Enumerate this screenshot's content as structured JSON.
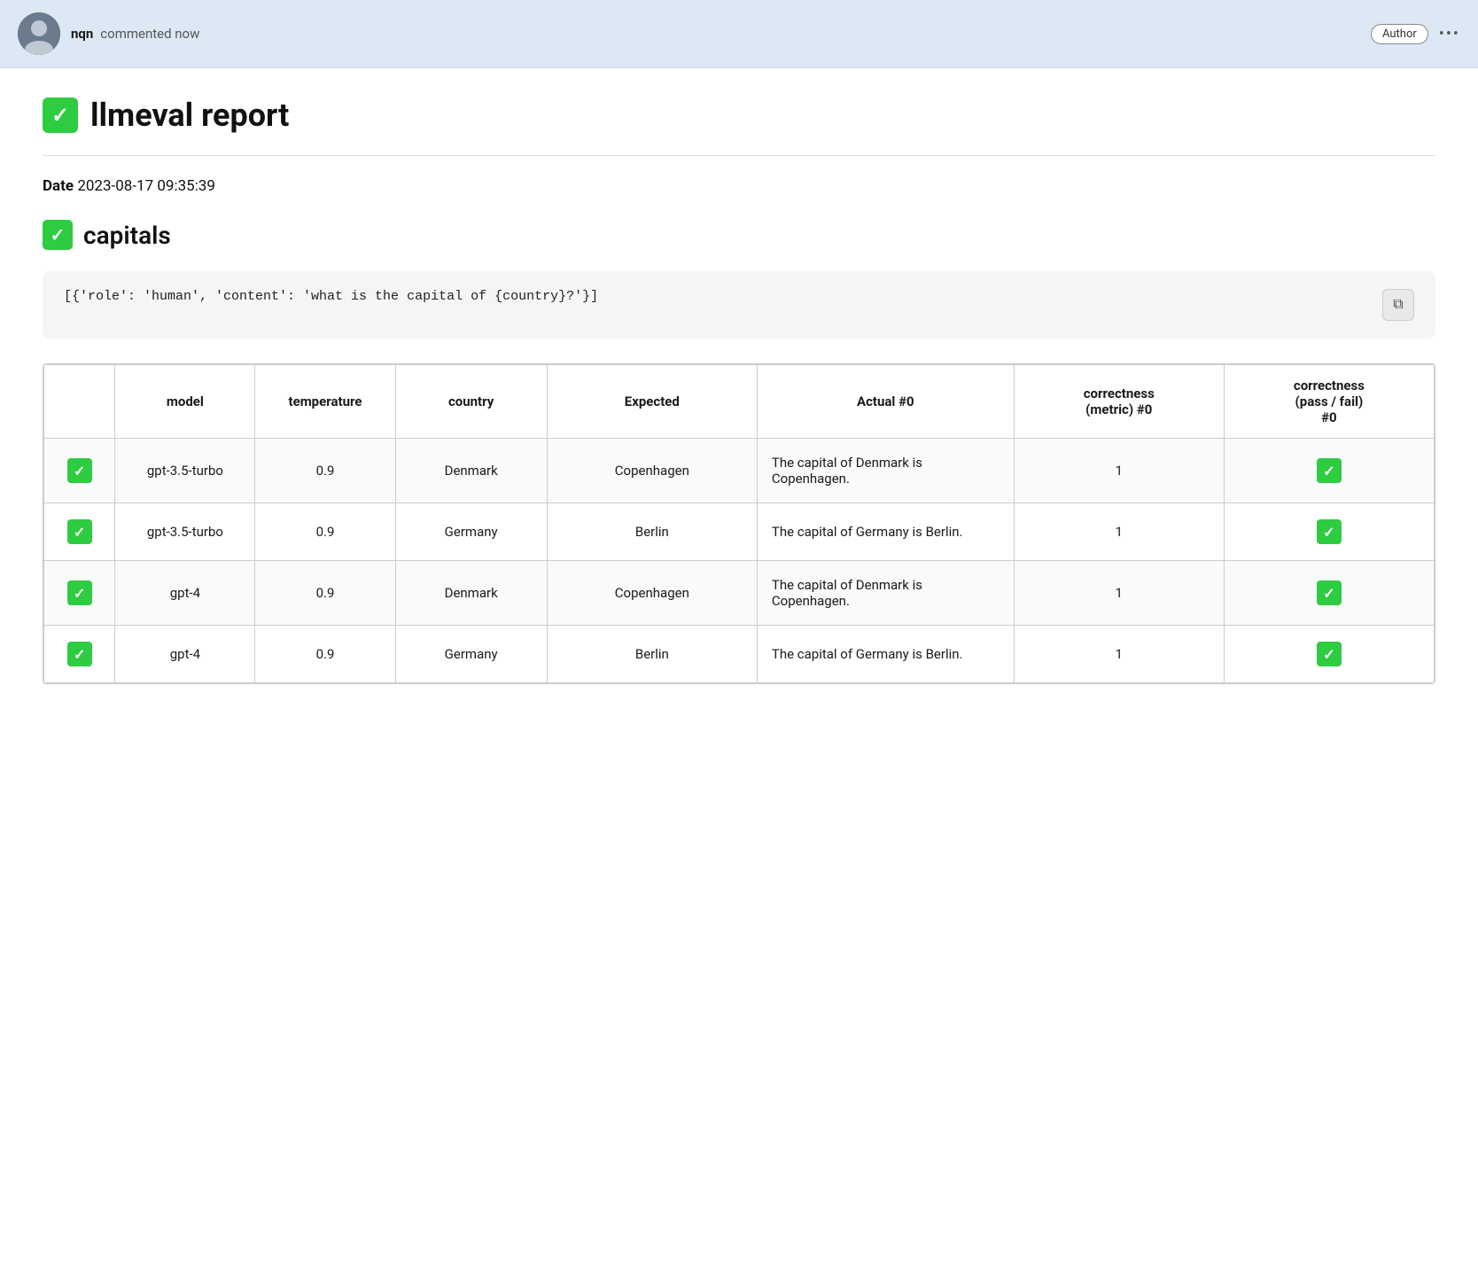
{
  "header": {
    "username": "nqn",
    "action": "commented now",
    "author_label": "Author",
    "more_icon": "•••"
  },
  "report": {
    "icon_alt": "green checkbox",
    "title": "llmeval report",
    "date_label": "Date",
    "date_value": "2023-08-17 09:35:39"
  },
  "section": {
    "icon_alt": "green checkbox",
    "title": "capitals"
  },
  "code_block": {
    "content": "[{'role': 'human', 'content': 'what is the capital of {country}?'}]",
    "copy_icon": "⧉"
  },
  "table": {
    "headers": [
      "",
      "model",
      "temperature",
      "country",
      "Expected",
      "Actual #0",
      "correctness\n(metric) #0",
      "correctness\n(pass / fail)\n#0"
    ],
    "rows": [
      {
        "check": true,
        "model": "gpt-3.5-turbo",
        "temperature": "0.9",
        "country": "Denmark",
        "expected": "Copenhagen",
        "actual": "The capital of Denmark is Copenhagen.",
        "correctness_metric": "1",
        "correctness_pass": true
      },
      {
        "check": true,
        "model": "gpt-3.5-turbo",
        "temperature": "0.9",
        "country": "Germany",
        "expected": "Berlin",
        "actual": "The capital of Germany is Berlin.",
        "correctness_metric": "1",
        "correctness_pass": true
      },
      {
        "check": true,
        "model": "gpt-4",
        "temperature": "0.9",
        "country": "Denmark",
        "expected": "Copenhagen",
        "actual": "The capital of Denmark is Copenhagen.",
        "correctness_metric": "1",
        "correctness_pass": true
      },
      {
        "check": true,
        "model": "gpt-4",
        "temperature": "0.9",
        "country": "Germany",
        "expected": "Berlin",
        "actual": "The capital of Germany is Berlin.",
        "correctness_metric": "1",
        "correctness_pass": true
      }
    ]
  }
}
